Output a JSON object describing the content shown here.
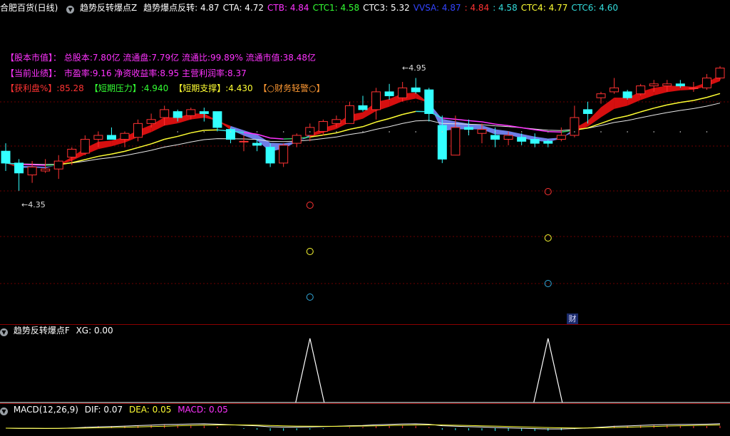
{
  "main_header": {
    "stock": "合肥百货(日线)",
    "indicator_name": "趋势反转爆点Z",
    "indicator_label": "趋势爆点反转",
    "values": [
      {
        "label": "趋势爆点反转:",
        "value": "4.87",
        "color": "#ffffff"
      },
      {
        "label": "CTA:",
        "value": "4.72",
        "color": "#ffffff"
      },
      {
        "label": "CTB:",
        "value": "4.84",
        "color": "#ff33ff"
      },
      {
        "label": "CTC1:",
        "value": "4.58",
        "color": "#33ff33"
      },
      {
        "label": "CTC3:",
        "value": "5.32",
        "color": "#ffffff"
      },
      {
        "label": "VVSA:",
        "value": "4.87",
        "color": "#3344ff"
      },
      {
        "label": ":",
        "value": "4.84",
        "color": "#ff3333"
      },
      {
        "label": ":",
        "value": "4.58",
        "color": "#33dddd"
      },
      {
        "label": "CTC4:",
        "value": "4.77",
        "color": "#ffff33"
      },
      {
        "label": "CTC6:",
        "value": "4.60",
        "color": "#33dddd"
      }
    ]
  },
  "info_lines": {
    "line1": "【股本市值】：  总股本:7.80亿 流通盘:7.79亿 流通比:99.89% 流通市值:38.48亿",
    "line2": "【当前业绩】：  市盈率:9.16 净资收益率:8.95 主营利润率:8.37",
    "line3": [
      {
        "text": "【获利盘%】:85.28",
        "color": "#ff3333"
      },
      {
        "text": "【短期压力】:4.940",
        "color": "#33ff33"
      },
      {
        "text": "【短期支撑】:4.430",
        "color": "#ffff33"
      },
      {
        "text": "【○财务轻警○】",
        "color": "#ff9933"
      }
    ]
  },
  "price_labels": {
    "high": "4.95",
    "low": "4.35"
  },
  "cai_label": "财",
  "panel2_header": {
    "name": "趋势反转爆点F",
    "values": "XG: 0.00"
  },
  "panel3_header": {
    "name": "MACD(12,26,9)",
    "dif": "DIF: 0.07",
    "dea": "DEA: 0.05",
    "macd": "MACD: 0.05"
  },
  "colors": {
    "bg": "#000000",
    "up": "#ff3333",
    "down": "#33ffff",
    "separator": "#8b0000"
  },
  "chart_data": {
    "type": "candlestick",
    "candles": [
      {
        "o": 4.58,
        "h": 4.62,
        "l": 4.48,
        "c": 4.52
      },
      {
        "o": 4.52,
        "h": 4.54,
        "l": 4.38,
        "c": 4.47
      },
      {
        "o": 4.46,
        "h": 4.53,
        "l": 4.42,
        "c": 4.5
      },
      {
        "o": 4.48,
        "h": 4.54,
        "l": 4.47,
        "c": 4.49
      },
      {
        "o": 4.49,
        "h": 4.56,
        "l": 4.44,
        "c": 4.53
      },
      {
        "o": 4.55,
        "h": 4.6,
        "l": 4.51,
        "c": 4.59
      },
      {
        "o": 4.57,
        "h": 4.66,
        "l": 4.56,
        "c": 4.64
      },
      {
        "o": 4.64,
        "h": 4.68,
        "l": 4.6,
        "c": 4.66
      },
      {
        "o": 4.66,
        "h": 4.7,
        "l": 4.64,
        "c": 4.64
      },
      {
        "o": 4.64,
        "h": 4.68,
        "l": 4.6,
        "c": 4.67
      },
      {
        "o": 4.65,
        "h": 4.74,
        "l": 4.63,
        "c": 4.72
      },
      {
        "o": 4.72,
        "h": 4.77,
        "l": 4.7,
        "c": 4.74
      },
      {
        "o": 4.75,
        "h": 4.81,
        "l": 4.71,
        "c": 4.79
      },
      {
        "o": 4.78,
        "h": 4.79,
        "l": 4.73,
        "c": 4.75
      },
      {
        "o": 4.76,
        "h": 4.8,
        "l": 4.74,
        "c": 4.79
      },
      {
        "o": 4.78,
        "h": 4.8,
        "l": 4.73,
        "c": 4.77
      },
      {
        "o": 4.78,
        "h": 4.78,
        "l": 4.68,
        "c": 4.7
      },
      {
        "o": 4.69,
        "h": 4.7,
        "l": 4.62,
        "c": 4.64
      },
      {
        "o": 4.63,
        "h": 4.66,
        "l": 4.58,
        "c": 4.63
      },
      {
        "o": 4.62,
        "h": 4.64,
        "l": 4.58,
        "c": 4.61
      },
      {
        "o": 4.6,
        "h": 4.62,
        "l": 4.5,
        "c": 4.52
      },
      {
        "o": 4.52,
        "h": 4.62,
        "l": 4.5,
        "c": 4.61
      },
      {
        "o": 4.62,
        "h": 4.67,
        "l": 4.6,
        "c": 4.66
      },
      {
        "o": 4.66,
        "h": 4.72,
        "l": 4.63,
        "c": 4.7
      },
      {
        "o": 4.68,
        "h": 4.74,
        "l": 4.66,
        "c": 4.73
      },
      {
        "o": 4.72,
        "h": 4.76,
        "l": 4.7,
        "c": 4.74
      },
      {
        "o": 4.72,
        "h": 4.83,
        "l": 4.72,
        "c": 4.81
      },
      {
        "o": 4.81,
        "h": 4.86,
        "l": 4.78,
        "c": 4.79
      },
      {
        "o": 4.79,
        "h": 4.9,
        "l": 4.74,
        "c": 4.88
      },
      {
        "o": 4.88,
        "h": 4.92,
        "l": 4.84,
        "c": 4.86
      },
      {
        "o": 4.85,
        "h": 4.93,
        "l": 4.83,
        "c": 4.9
      },
      {
        "o": 4.9,
        "h": 4.95,
        "l": 4.87,
        "c": 4.88
      },
      {
        "o": 4.89,
        "h": 4.9,
        "l": 4.73,
        "c": 4.77
      },
      {
        "o": 4.71,
        "h": 4.76,
        "l": 4.52,
        "c": 4.54
      },
      {
        "o": 4.56,
        "h": 4.76,
        "l": 4.56,
        "c": 4.7
      },
      {
        "o": 4.7,
        "h": 4.74,
        "l": 4.66,
        "c": 4.69
      },
      {
        "o": 4.67,
        "h": 4.72,
        "l": 4.62,
        "c": 4.69
      },
      {
        "o": 4.66,
        "h": 4.7,
        "l": 4.6,
        "c": 4.64
      },
      {
        "o": 4.64,
        "h": 4.68,
        "l": 4.61,
        "c": 4.66
      },
      {
        "o": 4.65,
        "h": 4.67,
        "l": 4.61,
        "c": 4.63
      },
      {
        "o": 4.64,
        "h": 4.67,
        "l": 4.6,
        "c": 4.62
      },
      {
        "o": 4.63,
        "h": 4.64,
        "l": 4.6,
        "c": 4.62
      },
      {
        "o": 4.64,
        "h": 4.7,
        "l": 4.63,
        "c": 4.66
      },
      {
        "o": 4.66,
        "h": 4.81,
        "l": 4.65,
        "c": 4.75
      },
      {
        "o": 4.79,
        "h": 4.83,
        "l": 4.72,
        "c": 4.77
      },
      {
        "o": 4.85,
        "h": 4.88,
        "l": 4.82,
        "c": 4.87
      },
      {
        "o": 4.88,
        "h": 4.95,
        "l": 4.87,
        "c": 4.9
      },
      {
        "o": 4.88,
        "h": 4.89,
        "l": 4.84,
        "c": 4.85
      },
      {
        "o": 4.87,
        "h": 4.92,
        "l": 4.86,
        "c": 4.91
      },
      {
        "o": 4.91,
        "h": 4.94,
        "l": 4.88,
        "c": 4.92
      },
      {
        "o": 4.91,
        "h": 4.94,
        "l": 4.88,
        "c": 4.92
      },
      {
        "o": 4.92,
        "h": 4.94,
        "l": 4.9,
        "c": 4.91
      },
      {
        "o": 4.9,
        "h": 4.93,
        "l": 4.88,
        "c": 4.9
      },
      {
        "o": 4.9,
        "h": 4.97,
        "l": 4.89,
        "c": 4.95
      },
      {
        "o": 4.95,
        "h": 5.01,
        "l": 4.94,
        "c": 5.0
      }
    ],
    "signal_days": [
      23,
      41
    ],
    "ylim": [
      4.3,
      5.02
    ]
  }
}
